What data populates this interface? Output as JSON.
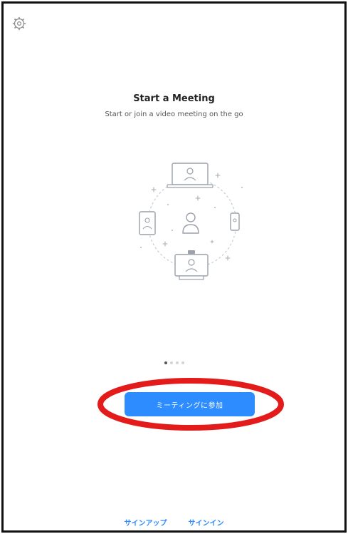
{
  "hero": {
    "title": "Start a Meeting",
    "subtitle": "Start or join a video meeting on the go"
  },
  "pager": {
    "total_pages": 4,
    "current_page": 1
  },
  "actions": {
    "join_meeting_label": "ミーティングに参加",
    "sign_up_label": "サインアップ",
    "sign_in_label": "サインイン"
  },
  "icons": {
    "settings": "gear-icon"
  },
  "colors": {
    "accent": "#2d8cff",
    "annotation": "#e31b1b"
  }
}
